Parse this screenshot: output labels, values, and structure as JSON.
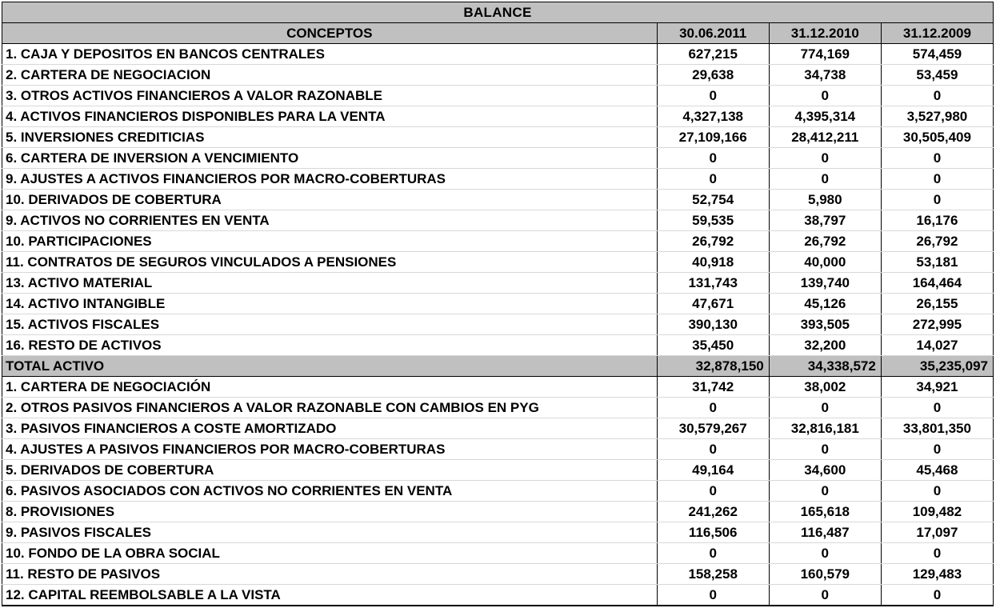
{
  "title": "BALANCE",
  "header": {
    "concept": "CONCEPTOS",
    "dates": [
      "30.06.2011",
      "31.12.2010",
      "31.12.2009"
    ]
  },
  "activo_rows": [
    {
      "concept": "1. CAJA Y DEPOSITOS EN BANCOS CENTRALES",
      "values": [
        "627,215",
        "774,169",
        "574,459"
      ]
    },
    {
      "concept": "2. CARTERA DE NEGOCIACION",
      "values": [
        "29,638",
        "34,738",
        "53,459"
      ]
    },
    {
      "concept": "3. OTROS ACTIVOS FINANCIEROS A VALOR RAZONABLE",
      "values": [
        "0",
        "0",
        "0"
      ]
    },
    {
      "concept": "4. ACTIVOS FINANCIEROS DISPONIBLES PARA LA VENTA",
      "values": [
        "4,327,138",
        "4,395,314",
        "3,527,980"
      ]
    },
    {
      "concept": "5. INVERSIONES CREDITICIAS",
      "values": [
        "27,109,166",
        "28,412,211",
        "30,505,409"
      ]
    },
    {
      "concept": "6. CARTERA DE INVERSION A VENCIMIENTO",
      "values": [
        "0",
        "0",
        "0"
      ]
    },
    {
      "concept": "9. AJUSTES A ACTIVOS FINANCIEROS POR MACRO-COBERTURAS",
      "values": [
        "0",
        "0",
        "0"
      ]
    },
    {
      "concept": "10. DERIVADOS DE COBERTURA",
      "values": [
        "52,754",
        "5,980",
        "0"
      ]
    },
    {
      "concept": "9. ACTIVOS NO CORRIENTES EN VENTA",
      "values": [
        "59,535",
        "38,797",
        "16,176"
      ]
    },
    {
      "concept": "10. PARTICIPACIONES",
      "values": [
        "26,792",
        "26,792",
        "26,792"
      ]
    },
    {
      "concept": "11. CONTRATOS DE SEGUROS VINCULADOS A PENSIONES",
      "values": [
        "40,918",
        "40,000",
        "53,181"
      ]
    },
    {
      "concept": "13. ACTIVO MATERIAL",
      "values": [
        "131,743",
        "139,740",
        "164,464"
      ]
    },
    {
      "concept": "14. ACTIVO INTANGIBLE",
      "values": [
        "47,671",
        "45,126",
        "26,155"
      ]
    },
    {
      "concept": "15. ACTIVOS FISCALES",
      "values": [
        "390,130",
        "393,505",
        "272,995"
      ]
    },
    {
      "concept": "16. RESTO DE  ACTIVOS",
      "values": [
        "35,450",
        "32,200",
        "14,027"
      ]
    }
  ],
  "total_activo": {
    "concept": "TOTAL ACTIVO",
    "values": [
      "32,878,150",
      "34,338,572",
      "35,235,097"
    ]
  },
  "pasivo_rows": [
    {
      "concept": "1. CARTERA DE NEGOCIACIÓN",
      "values": [
        "31,742",
        "38,002",
        "34,921"
      ]
    },
    {
      "concept": "2. OTROS PASIVOS FINANCIEROS A VALOR RAZONABLE CON CAMBIOS EN PYG",
      "values": [
        "0",
        "0",
        "0"
      ]
    },
    {
      "concept": "3. PASIVOS FINANCIEROS A COSTE AMORTIZADO",
      "values": [
        "30,579,267",
        "32,816,181",
        "33,801,350"
      ]
    },
    {
      "concept": "4. AJUSTES A PASIVOS FINANCIEROS POR MACRO-COBERTURAS",
      "values": [
        "0",
        "0",
        "0"
      ]
    },
    {
      "concept": "5. DERIVADOS DE COBERTURA",
      "values": [
        "49,164",
        "34,600",
        "45,468"
      ]
    },
    {
      "concept": "6. PASIVOS ASOCIADOS CON ACTIVOS NO CORRIENTES EN VENTA",
      "values": [
        "0",
        "0",
        "0"
      ]
    },
    {
      "concept": "8. PROVISIONES",
      "values": [
        "241,262",
        "165,618",
        "109,482"
      ]
    },
    {
      "concept": "9. PASIVOS FISCALES",
      "values": [
        "116,506",
        "116,487",
        "17,097"
      ]
    },
    {
      "concept": "10. FONDO DE LA OBRA SOCIAL",
      "values": [
        "0",
        "0",
        "0"
      ]
    },
    {
      "concept": "11. RESTO DE PASIVOS",
      "values": [
        "158,258",
        "160,579",
        "129,483"
      ]
    },
    {
      "concept": "12. CAPITAL REEMBOLSABLE A LA VISTA",
      "values": [
        "0",
        "0",
        "0"
      ]
    }
  ],
  "colors": {
    "header_background": "#c0c0c0",
    "grid_line": "#000000",
    "row_separator": "#d8d8d8"
  }
}
